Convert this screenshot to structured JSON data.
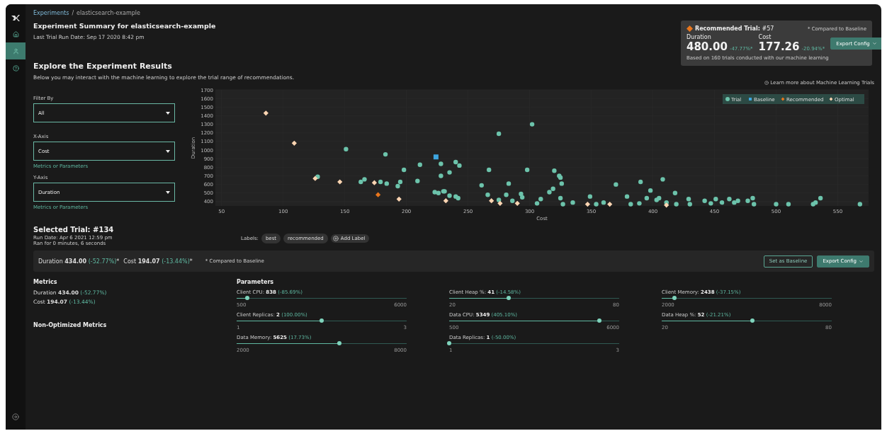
{
  "sidebar": {
    "items": [
      {
        "kind": "home",
        "selected": false
      },
      {
        "kind": "user",
        "selected": true
      },
      {
        "kind": "help",
        "selected": false
      }
    ]
  },
  "breadcrumb": {
    "parent": "Experiments",
    "separator": "/",
    "current": "elasticsearch-example"
  },
  "header": {
    "title": "Experiment Summary for elasticsearch-example",
    "subtitle": "Last Trial Run Date: Sep 17 2020 8:42 pm"
  },
  "recommended": {
    "title": "Recommended Trial:",
    "trial": "#57",
    "note": "* Compared to Baseline",
    "metrics": [
      {
        "label": "Duration",
        "value": "480.00",
        "change": "-47.77%*"
      },
      {
        "label": "Cost",
        "value": "177.26",
        "change": "-20.94%*"
      }
    ],
    "button": "Export Config",
    "footer": "Based on 160 trials conducted with our machine learning"
  },
  "explore": {
    "title": "Explore the Experiment Results",
    "description": "Below you may interact with the machine learning to explore the trial range of recommendations.",
    "learn_more": "Learn more about Machine Learning Trials"
  },
  "filters": [
    {
      "label": "Filter By",
      "value": "All"
    },
    {
      "label": "X-Axis",
      "value": "Cost",
      "hint": "Metrics or Parameters"
    },
    {
      "label": "Y-Axis",
      "value": "Duration",
      "hint": "Metrics or Parameters"
    }
  ],
  "chart_data": {
    "type": "scatter",
    "legend": true,
    "xlabel": "Cost",
    "ylabel": "Duration",
    "xlim": [
      45,
      575
    ],
    "ylim": [
      350,
      1700
    ],
    "xticks": [
      50,
      100,
      150,
      200,
      250,
      300,
      350,
      400,
      450,
      500,
      550
    ],
    "yticks": [
      400,
      500,
      600,
      700,
      800,
      900,
      1000,
      1100,
      1200,
      1300,
      1400,
      1500,
      1600,
      1700
    ],
    "series": [
      {
        "name": "Trial",
        "color": "#6cc3ab",
        "x": [
          151,
          183,
          128,
          166,
          163,
          179,
          184,
          195,
          193,
          198,
          209,
          211,
          223,
          226,
          230,
          228,
          228,
          235,
          240,
          243,
          231,
          235,
          240,
          242,
          261,
          267,
          266,
          275,
          275,
          281,
          283,
          286,
          293,
          294,
          298,
          302,
          309,
          306,
          316,
          319,
          320,
          324,
          325,
          326,
          325,
          327,
          335,
          349,
          354,
          360,
          370,
          379,
          382,
          390,
          389,
          395,
          398,
          403,
          405,
          408,
          411,
          418,
          419,
          429,
          430,
          442,
          447,
          451,
          456,
          462,
          466,
          469,
          477,
          481,
          482,
          500,
          510,
          530,
          532,
          536,
          568
        ],
        "values": [
          1010,
          950,
          690,
          660,
          630,
          630,
          610,
          630,
          580,
          770,
          640,
          830,
          510,
          500,
          520,
          840,
          700,
          740,
          860,
          820,
          520,
          470,
          460,
          440,
          590,
          770,
          480,
          1190,
          420,
          480,
          610,
          410,
          490,
          450,
          770,
          1300,
          430,
          380,
          510,
          550,
          760,
          700,
          680,
          610,
          440,
          370,
          390,
          460,
          370,
          390,
          600,
          460,
          370,
          630,
          380,
          440,
          530,
          420,
          440,
          660,
          390,
          500,
          370,
          430,
          370,
          410,
          380,
          430,
          390,
          430,
          390,
          410,
          410,
          440,
          370,
          370,
          370,
          370,
          390,
          440,
          370
        ]
      },
      {
        "name": "Baseline",
        "color": "#3ea6e0",
        "x": [
          224
        ],
        "values": [
          920
        ]
      },
      {
        "name": "Recommended",
        "color": "#e8761c",
        "x": [
          177
        ],
        "values": [
          480
        ]
      },
      {
        "name": "Optimal",
        "color": "#fcd5b2",
        "x": [
          86,
          109,
          126,
          146,
          174,
          194,
          232,
          269,
          276,
          290,
          347,
          365,
          411
        ],
        "values": [
          1430,
          1080,
          670,
          630,
          620,
          430,
          410,
          410,
          380,
          380,
          370,
          370,
          360
        ]
      }
    ]
  },
  "selected_trial": {
    "title": "Selected Trial: #134",
    "run_date": "Run Date: Apr 6 2021 12:59 pm",
    "run_time": "Ran for 0 minutes, 6 seconds",
    "labels_caption": "Labels:",
    "labels": [
      "best",
      "recommended"
    ],
    "add_label": "Add Label"
  },
  "summary_bar": {
    "items": [
      {
        "label": "Duration",
        "value": "434.00",
        "change": "(-52.77%)",
        "mark": "*"
      },
      {
        "label": "Cost",
        "value": "194.07",
        "change": "(-13.44%)",
        "mark": "*"
      }
    ],
    "note": "* Compared to Baseline",
    "buttons": [
      {
        "label": "Set as Baseline",
        "kind": "outline"
      },
      {
        "label": "Export Config",
        "kind": "filled"
      }
    ]
  },
  "metrics": {
    "title": "Metrics",
    "items": [
      {
        "label": "Duration",
        "value": "434.00",
        "change": "(-52.77%)"
      },
      {
        "label": "Cost",
        "value": "194.07",
        "change": "(-13.44%)"
      }
    ]
  },
  "non_optimized": {
    "title": "Non-Optimized Metrics"
  },
  "parameters": {
    "title": "Parameters",
    "items": [
      {
        "label": "Client CPU:",
        "value": "838",
        "change": "(-85.69%)",
        "min": "500",
        "max": "6000",
        "level": 0.061
      },
      {
        "label": "Client Heap %:",
        "value": "41",
        "change": "(-14.58%)",
        "min": "20",
        "max": "80",
        "level": 0.35
      },
      {
        "label": "Client Memory:",
        "value": "2438",
        "change": "(-37.15%)",
        "min": "2000",
        "max": "8000",
        "level": 0.073
      },
      {
        "label": "Client Replicas:",
        "value": "2",
        "change": "(100.00%)",
        "min": "1",
        "max": "3",
        "level": 0.5
      },
      {
        "label": "Data CPU:",
        "value": "5349",
        "change": "(405.10%)",
        "min": "500",
        "max": "6000",
        "level": 0.882
      },
      {
        "label": "Data Heap %:",
        "value": "52",
        "change": "(-21.21%)",
        "min": "20",
        "max": "80",
        "level": 0.533
      },
      {
        "label": "Data Memory:",
        "value": "5625",
        "change": "(17.73%)",
        "min": "2000",
        "max": "8000",
        "level": 0.604
      },
      {
        "label": "Data Replicas:",
        "value": "1",
        "change": "(-50.00%)",
        "min": "1",
        "max": "3",
        "level": 0
      }
    ]
  }
}
